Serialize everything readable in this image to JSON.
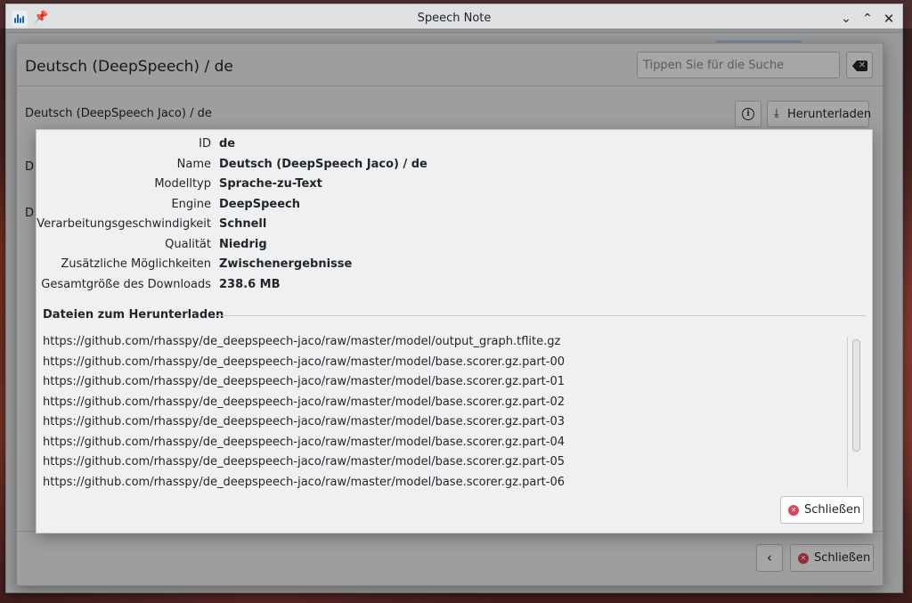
{
  "window": {
    "title": "Speech Note"
  },
  "models_dialog": {
    "title": "Deutsch (DeepSpeech) / de",
    "search_placeholder": "Tippen Sie für die Suche",
    "model_title": "Deutsch (DeepSpeech Jaco) / de",
    "download_label": "Herunterladen",
    "stub_1": "D",
    "stub_2": "D",
    "close_label": "Schließen"
  },
  "details_dialog": {
    "properties": [
      {
        "label": "ID",
        "value": "de"
      },
      {
        "label": "Name",
        "value": "Deutsch (DeepSpeech Jaco) / de"
      },
      {
        "label": "Modelltyp",
        "value": "Sprache-zu-Text"
      },
      {
        "label": "Engine",
        "value": "DeepSpeech"
      },
      {
        "label": "Verarbeitungsgeschwindigkeit",
        "value": "Schnell"
      },
      {
        "label": "Qualität",
        "value": "Niedrig"
      },
      {
        "label": "Zusätzliche Möglichkeiten",
        "value": "Zwischenergebnisse"
      },
      {
        "label": "Gesamtgröße des Downloads",
        "value": "238.6 MB"
      }
    ],
    "files_heading": "Dateien zum Herunterladen",
    "files": [
      "https://github.com/rhasspy/de_deepspeech-jaco/raw/master/model/output_graph.tflite.gz",
      "https://github.com/rhasspy/de_deepspeech-jaco/raw/master/model/base.scorer.gz.part-00",
      "https://github.com/rhasspy/de_deepspeech-jaco/raw/master/model/base.scorer.gz.part-01",
      "https://github.com/rhasspy/de_deepspeech-jaco/raw/master/model/base.scorer.gz.part-02",
      "https://github.com/rhasspy/de_deepspeech-jaco/raw/master/model/base.scorer.gz.part-03",
      "https://github.com/rhasspy/de_deepspeech-jaco/raw/master/model/base.scorer.gz.part-04",
      "https://github.com/rhasspy/de_deepspeech-jaco/raw/master/model/base.scorer.gz.part-05",
      "https://github.com/rhasspy/de_deepspeech-jaco/raw/master/model/base.scorer.gz.part-06"
    ],
    "close_label": "Schließen"
  },
  "icons": {
    "app": "speech-note-icon",
    "pin": "pin-icon",
    "info": "info-icon",
    "download": "download-icon",
    "clear": "backspace-icon",
    "close": "close-circle-icon",
    "back": "chevron-left-icon"
  },
  "colors": {
    "accent": "#1d62c6",
    "close_red": "#da4453"
  }
}
